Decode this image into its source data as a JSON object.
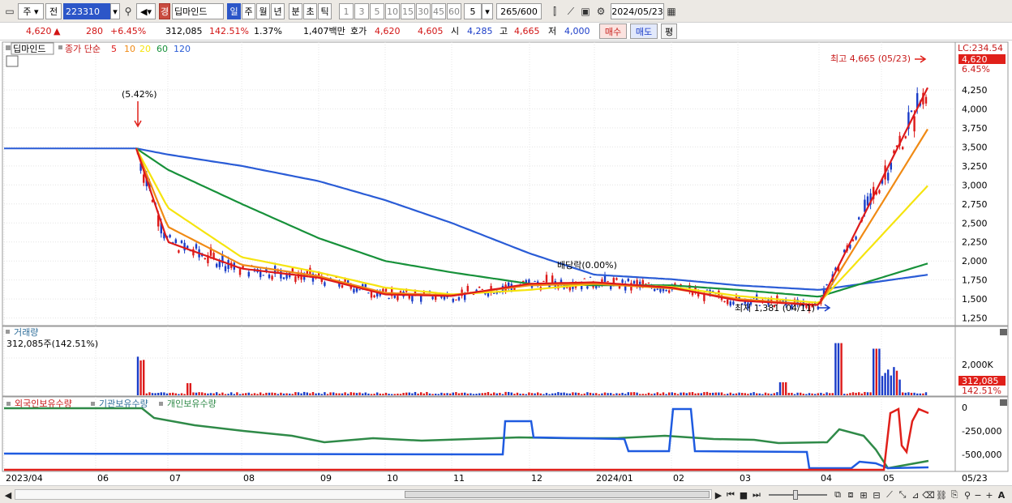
{
  "toolbar": {
    "market": "주",
    "type": "전",
    "code": "223310",
    "name_tag": "경",
    "name": "딥마인드",
    "periods": [
      "일",
      "주",
      "월",
      "년",
      "분",
      "초",
      "틱"
    ],
    "active_period": "일",
    "intervals": [
      "1",
      "3",
      "5",
      "10",
      "15",
      "30",
      "45",
      "60"
    ],
    "count": "5",
    "zoom": "265/600",
    "date": "2024/05/23"
  },
  "quote": {
    "price": "4,620",
    "arrow": "▲",
    "change": "280",
    "change_pct": "+6.45%",
    "volume": "312,085",
    "volume_ratio": "142.51%",
    "turnover": "1.37%",
    "amount": "1,407백만",
    "bid_label": "호가",
    "bid": "4,620",
    "ask": "4,605",
    "open_label": "시",
    "open": "4,285",
    "high_label": "고",
    "high": "4,665",
    "low_label": "저",
    "low": "4,000",
    "buy": "매수",
    "sell": "매도",
    "avg": "평"
  },
  "legend": {
    "name": "딥마인드",
    "ma_label": "종가 단순",
    "periods": [
      "5",
      "10",
      "20",
      "60",
      "120"
    ],
    "colors": [
      "#dd1a1a",
      "#f08a14",
      "#f5e40e",
      "#17913a",
      "#2a5cd6"
    ]
  },
  "colors": {
    "up": "#dd1a1a",
    "down": "#1a3cc8",
    "foreign": "#2f8a48",
    "inst": "#1f5be0",
    "bg": "#ffffff",
    "grid": "#e4e4e4"
  },
  "price_axis": {
    "label": "LC:234.54",
    "ticks": [
      "4,250",
      "4,000",
      "3,750",
      "3,500",
      "3,250",
      "3,000",
      "2,750",
      "2,500",
      "2,250",
      "2,000",
      "1,750",
      "1,500",
      "1,250"
    ],
    "last": "4,620",
    "last_pct": "6.45%"
  },
  "annotations": {
    "high": "최고 4,665 (05/23)",
    "low": "최저 1,381 (04/11)",
    "event1": "(5.42%)",
    "dividend": "배당락(0.00%)"
  },
  "volume_panel": {
    "title": "거래량",
    "value": "312,085주(142.51%)",
    "tick": "2,000K",
    "last": "312,085",
    "last_pct": "142.51%"
  },
  "holdings_panel": {
    "labels": [
      "외국인보유수량",
      "기관보유수량",
      "개인보유수량"
    ],
    "ticks": [
      "0",
      "-250,000",
      "-500,000"
    ]
  },
  "x_axis": {
    "labels": [
      "2023/04",
      "06",
      "07",
      "08",
      "09",
      "10",
      "11",
      "12",
      "2024/01",
      "02",
      "03",
      "04",
      "05",
      "05/23"
    ]
  },
  "chart_data": {
    "type": "line",
    "title": "",
    "series": [
      {
        "name": "5",
        "x": [
          "2023/06",
          "2023/07",
          "2023/08",
          "2023/09",
          "2023/10",
          "2023/11",
          "2023/12",
          "2024/01",
          "2024/02",
          "2024/03",
          "2024/04",
          "2024/05/23"
        ],
        "values": [
          3480,
          2250,
          1900,
          1780,
          1560,
          1540,
          1700,
          1720,
          1650,
          1480,
          1420,
          4300
        ]
      },
      {
        "name": "10",
        "x": [
          "2023/06",
          "2023/07",
          "2023/08",
          "2023/09",
          "2023/10",
          "2023/11",
          "2023/12",
          "2024/01",
          "2024/02",
          "2024/03",
          "2024/04",
          "2024/05/23"
        ],
        "values": [
          3480,
          2450,
          1950,
          1800,
          1580,
          1550,
          1680,
          1700,
          1640,
          1500,
          1420,
          3750
        ]
      },
      {
        "name": "20",
        "x": [
          "2023/06",
          "2023/07",
          "2023/08",
          "2023/09",
          "2023/10",
          "2023/11",
          "2023/12",
          "2024/01",
          "2024/02",
          "2024/03",
          "2024/04",
          "2024/05/23"
        ],
        "values": [
          3480,
          2700,
          2050,
          1850,
          1650,
          1560,
          1620,
          1700,
          1660,
          1540,
          1450,
          3000
        ]
      },
      {
        "name": "60",
        "x": [
          "2023/06",
          "2023/07",
          "2023/08",
          "2023/09",
          "2023/10",
          "2023/11",
          "2023/12",
          "2024/01",
          "2024/02",
          "2024/03",
          "2024/04",
          "2024/05/23"
        ],
        "values": [
          3480,
          3200,
          2750,
          2300,
          2000,
          1850,
          1700,
          1680,
          1680,
          1620,
          1530,
          1970
        ]
      },
      {
        "name": "120",
        "x": [
          "2023/06",
          "2023/07",
          "2023/08",
          "2023/09",
          "2023/10",
          "2023/11",
          "2023/12",
          "2024/01",
          "2024/02",
          "2024/03",
          "2024/04",
          "2024/05/23"
        ],
        "values": [
          3480,
          3400,
          3250,
          3050,
          2800,
          2500,
          2100,
          1820,
          1760,
          1680,
          1620,
          1820
        ]
      }
    ],
    "ylim": [
      1200,
      4750
    ]
  }
}
